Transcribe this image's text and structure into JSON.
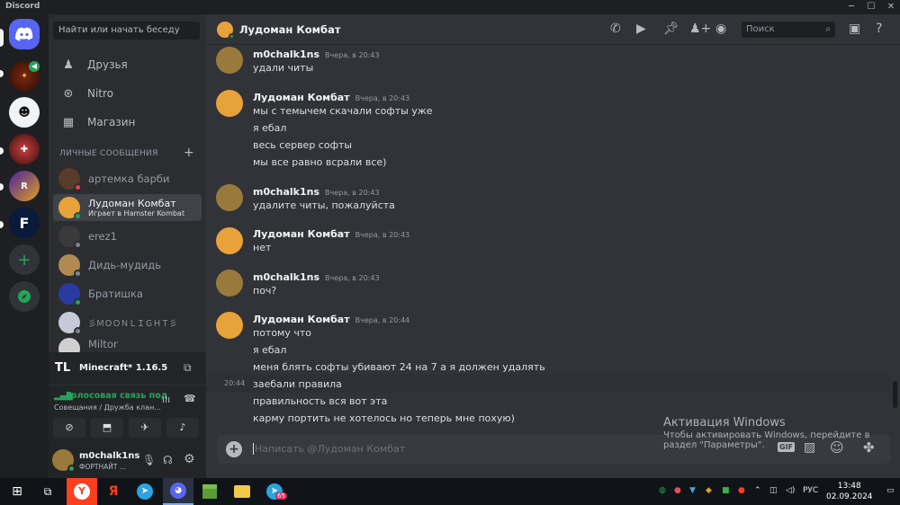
{
  "window": {
    "title": "Discord"
  },
  "dm_panel": {
    "search_placeholder": "Найти или начать беседу",
    "nav": [
      "Друзья",
      "Nitro",
      "Магазин"
    ],
    "dm_header": "ЛИЧНЫЕ СООБЩЕНИЯ",
    "dms": [
      {
        "name": "артемка барби",
        "sub": "",
        "status": "dnd"
      },
      {
        "name": "Лудоман Комбат",
        "sub": "Играет в Hamster Kombat",
        "status": "online"
      },
      {
        "name": "erez1",
        "sub": "",
        "status": "offline"
      },
      {
        "name": "Дидь-мудидь",
        "sub": "",
        "status": "offline"
      },
      {
        "name": "Братишка",
        "sub": "",
        "status": "online"
      },
      {
        "name": "彡ＭＯＯＮＬＩＧＨＴ彡",
        "sub": "",
        "status": "offline"
      },
      {
        "name": "Miltor",
        "sub": "",
        "status": "offline"
      }
    ]
  },
  "activity": {
    "badge": "TL",
    "title": "Minecraft* 1.16.5"
  },
  "voice": {
    "status": "Голосовая связь под",
    "channel": "Совещания / Дружба клан..."
  },
  "user": {
    "name": "m0chalk1ns",
    "status": "ФОРТНАЙТ ..."
  },
  "chat": {
    "recipient": "Лудоман Комбат",
    "search_placeholder": "Поиск",
    "composer_placeholder": "Написать @Лудоман Комбат",
    "composer_gif": "GIF",
    "messages": [
      {
        "author": "m0chalk1ns",
        "time": "Вчера, в 20:43",
        "lines": [
          "удали читы"
        ]
      },
      {
        "author": "Лудоман Комбат",
        "time": "Вчера, в 20:43",
        "lines": [
          "мы с темычем скачали софты уже",
          "я ебал",
          "весь сервер софты",
          "мы все равно всрали все)"
        ]
      },
      {
        "author": "m0chalk1ns",
        "time": "Вчера, в 20:43",
        "lines": [
          "удалите читы, пожалуйста"
        ]
      },
      {
        "author": "Лудоман Комбат",
        "time": "Вчера, в 20:43",
        "lines": [
          "нет"
        ]
      },
      {
        "author": "m0chalk1ns",
        "time": "Вчера, в 20:43",
        "lines": [
          "поч?"
        ]
      },
      {
        "author": "Лудоман Комбат",
        "time": "Вчера, в 20:44",
        "lines": [
          "потому что",
          "я ебал",
          "меня блять софты убивают 24 на 7 а я должен удалять",
          "заебали правила",
          "правильность вся вот эта",
          "карму портить не хотелось но теперь мне похую)"
        ]
      }
    ],
    "hover_time": "20:44"
  },
  "watermark": {
    "title": "Активация Windows",
    "line1": "Чтобы активировать Windows, перейдите в",
    "line2": "раздел \"Параметры\"."
  },
  "taskbar": {
    "lang": "РУС",
    "time": "13:48",
    "date": "02.09.2024",
    "telegram_badge": "65"
  },
  "colors": {
    "blurple": "#5865f2",
    "online": "#23a559",
    "dnd": "#f23f43",
    "offline": "#80848e",
    "yandex": "#fc3f1d",
    "hamster": "#e8a23a",
    "mochalka": "#9a7a3c"
  }
}
